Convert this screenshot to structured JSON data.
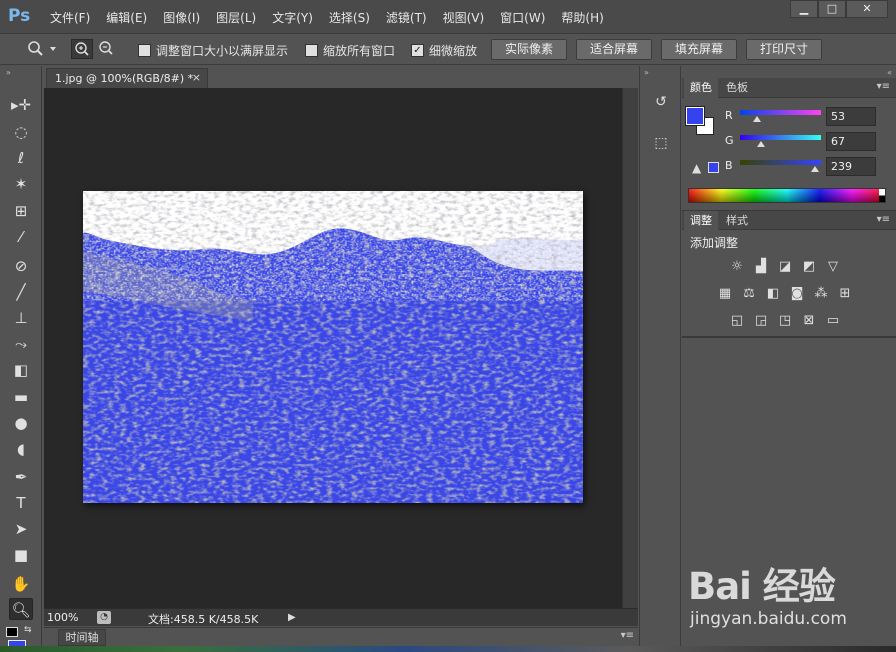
{
  "app": {
    "logo": "Ps"
  },
  "menu": [
    "文件(F)",
    "编辑(E)",
    "图像(I)",
    "图层(L)",
    "文字(Y)",
    "选择(S)",
    "滤镜(T)",
    "视图(V)",
    "窗口(W)",
    "帮助(H)"
  ],
  "window_controls": {
    "minimize": "▁",
    "maximize": "□",
    "close": "✕"
  },
  "options": {
    "resize_windows_label": "调整窗口大小以满屏显示",
    "resize_windows_checked": false,
    "zoom_all_label": "缩放所有窗口",
    "zoom_all_checked": false,
    "scrubby_label": "细微缩放",
    "scrubby_checked": true,
    "btn_actual": "实际像素",
    "btn_fit": "适合屏幕",
    "btn_fill": "填充屏幕",
    "btn_print": "打印尺寸"
  },
  "document": {
    "tab_label": "1.jpg @ 100%(RGB/8#) *",
    "close": "×",
    "zoom": "100%",
    "info": "文档:458.5 K/458.5K"
  },
  "timeline": {
    "tab": "时间轴"
  },
  "color_panel": {
    "tabs": [
      "颜色",
      "色板"
    ],
    "foreground": "#3543ef",
    "background": "#ffffff",
    "channels": [
      {
        "label": "R",
        "value": "53"
      },
      {
        "label": "G",
        "value": "67"
      },
      {
        "label": "B",
        "value": "239"
      }
    ]
  },
  "adjust_panel": {
    "tabs": [
      "调整",
      "样式"
    ],
    "title": "添加调整"
  },
  "watermark": {
    "logo": "Bai 经验",
    "url": "jingyan.baidu.com"
  }
}
